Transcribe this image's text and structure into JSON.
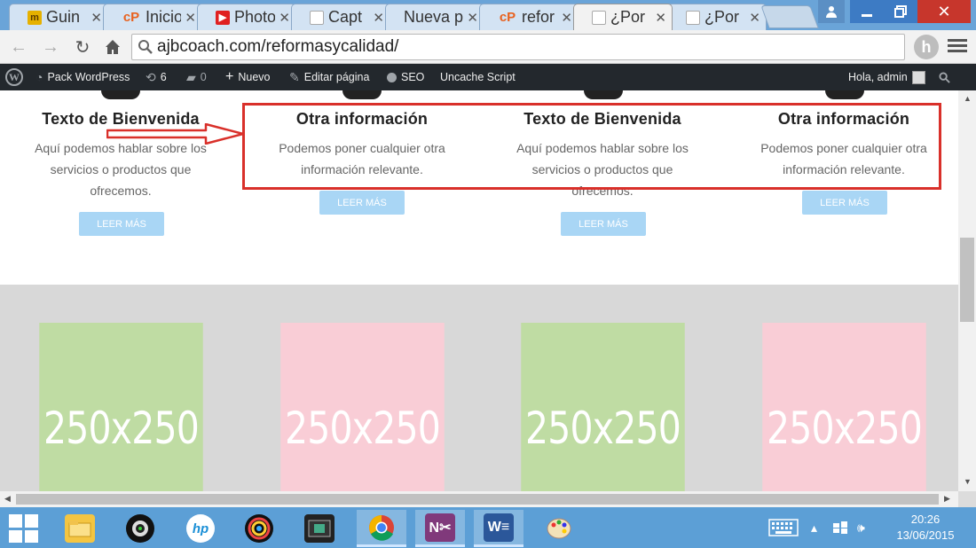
{
  "browser": {
    "tabs": [
      {
        "title": "Guin",
        "favicon": "m-icon"
      },
      {
        "title": "Inicio",
        "favicon": "cp-icon"
      },
      {
        "title": "Photo",
        "favicon": "youtube-icon"
      },
      {
        "title": "Capt",
        "favicon": "document-icon"
      },
      {
        "title": "Nueva p",
        "favicon": "none"
      },
      {
        "title": "refor",
        "favicon": "cp-icon"
      },
      {
        "title": "¿Por",
        "favicon": "document-icon",
        "active": true
      },
      {
        "title": "¿Por",
        "favicon": "document-icon"
      }
    ],
    "url": "ajbcoach.com/reformasycalidad/",
    "extension_letter": "h"
  },
  "adminbar": {
    "site": "Pack WordPress",
    "updates": "6",
    "comments": "0",
    "new": "Nuevo",
    "edit": "Editar página",
    "seo": "SEO",
    "uncache": "Uncache Script",
    "greeting": "Hola, admin"
  },
  "features": [
    {
      "title": "Texto de Bienvenida",
      "text": "Aquí podemos hablar sobre los servicios o productos que ofrecemos.",
      "button": "LEER MÁS"
    },
    {
      "title": "Otra información",
      "text": "Podemos poner cualquier otra información relevante.",
      "button": "LEER MÁS"
    },
    {
      "title": "Texto de Bienvenida",
      "text": "Aquí podemos hablar sobre los servicios o productos que ofrecemos.",
      "button": "LEER MÁS"
    },
    {
      "title": "Otra información",
      "text": "Podemos poner cualquier otra información relevante.",
      "button": "LEER MÁS"
    }
  ],
  "placeholders": [
    "250x250",
    "250x250",
    "250x250",
    "250x250"
  ],
  "taskbar": {
    "time": "20:26",
    "date": "13/06/2015",
    "apps": [
      "file-explorer",
      "camera-app",
      "hp",
      "media-player",
      "video-editor",
      "chrome",
      "onenote",
      "word",
      "paint"
    ]
  },
  "colors": {
    "annotation": "#d9302a",
    "placeholder_green": "#bfdca3",
    "placeholder_pink": "#f9cdd6",
    "button": "#a9d6f5",
    "adminbar": "#23282d"
  }
}
